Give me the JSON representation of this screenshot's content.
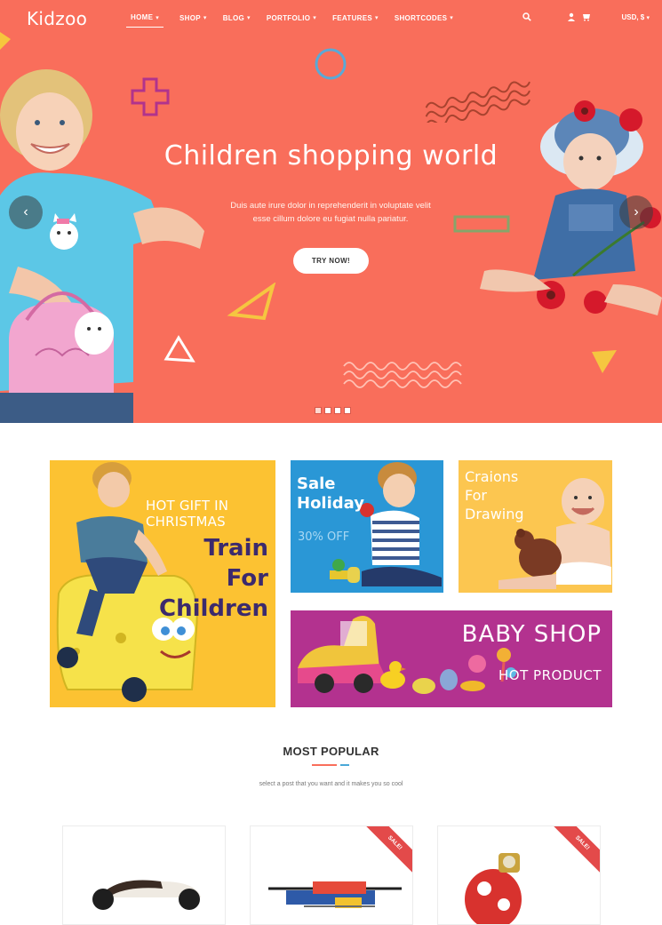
{
  "brand": {
    "name": "Kidzoo"
  },
  "nav": {
    "items": [
      {
        "label": "HOME"
      },
      {
        "label": "SHOP"
      },
      {
        "label": "BLOG"
      },
      {
        "label": "PORTFOLIO"
      },
      {
        "label": "FEATURES"
      },
      {
        "label": "SHORTCODES"
      }
    ],
    "currency": "USD, $"
  },
  "hero": {
    "title": "Children shopping world",
    "subtitle": "Duis aute irure dolor in reprehenderit in voluptate velit esse cillum dolore eu fugiat nulla pariatur.",
    "button": "TRY NOW!",
    "slide_count": 4,
    "active_slide": 1
  },
  "banners": {
    "train": {
      "tag": "HOT GIFT IN CHRISTMAS",
      "line1": "Train",
      "line2": "For",
      "line3": "Children"
    },
    "sale": {
      "line1": "Sale",
      "line2": "Holiday",
      "offer": "30% OFF"
    },
    "crayon": {
      "line1": "Craions",
      "line2": "For",
      "line3": "Drawing"
    },
    "baby": {
      "title": "BABY SHOP",
      "subtitle": "HOT PRODUCT"
    }
  },
  "popular": {
    "title": "MOST POPULAR",
    "subtitle": "select a post that you want and it makes you so cool",
    "cards": [
      {
        "ribbon": ""
      },
      {
        "ribbon": "SALE!"
      },
      {
        "ribbon": "SALE!"
      }
    ]
  },
  "colors": {
    "hero_bg": "#f96e5b",
    "train_bg": "#fcc232",
    "sale_bg": "#2a97d6",
    "crayon_bg": "#fcc650",
    "baby_bg": "#b3328f",
    "ribbon": "#e34a4a",
    "accent_red": "#f96e5b",
    "accent_blue": "#4aa8d8"
  }
}
